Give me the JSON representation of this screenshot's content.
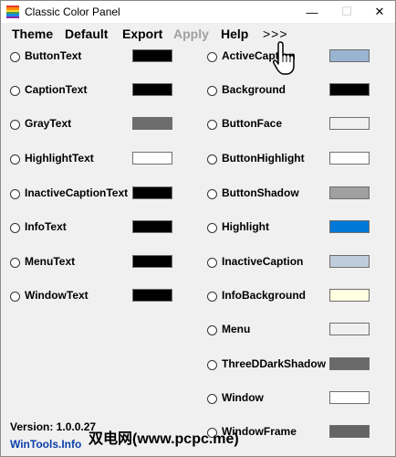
{
  "window": {
    "title": "Classic Color Panel",
    "caption_buttons": {
      "minimize": "—",
      "maximize": "☐",
      "close": "✕"
    }
  },
  "menu": {
    "theme": "Theme",
    "default": "Default",
    "export": "Export",
    "apply": "Apply",
    "help": "Help",
    "more": ">>>"
  },
  "left_column": [
    {
      "label": "ButtonText",
      "color": "#000000"
    },
    {
      "label": "CaptionText",
      "color": "#000000"
    },
    {
      "label": "GrayText",
      "color": "#6d6d6d"
    },
    {
      "label": "HighlightText",
      "color": "#ffffff"
    },
    {
      "label": "InactiveCaptionText",
      "color": "#000000"
    },
    {
      "label": "InfoText",
      "color": "#000000"
    },
    {
      "label": "MenuText",
      "color": "#000000"
    },
    {
      "label": "WindowText",
      "color": "#000000"
    }
  ],
  "right_column": [
    {
      "label": "ActiveCaption",
      "color": "#99b4d1"
    },
    {
      "label": "Background",
      "color": "#000000"
    },
    {
      "label": "ButtonFace",
      "color": "#f0f0f0"
    },
    {
      "label": "ButtonHighlight",
      "color": "#ffffff"
    },
    {
      "label": "ButtonShadow",
      "color": "#a0a0a0"
    },
    {
      "label": "Highlight",
      "color": "#0078d7"
    },
    {
      "label": "InactiveCaption",
      "color": "#bfcddb"
    },
    {
      "label": "InfoBackground",
      "color": "#ffffe1"
    },
    {
      "label": "Menu",
      "color": "#f0f0f0"
    },
    {
      "label": "ThreeDDarkShadow",
      "color": "#696969"
    },
    {
      "label": "Window",
      "color": "#ffffff"
    },
    {
      "label": "WindowFrame",
      "color": "#646464"
    }
  ],
  "footer": {
    "version": "Version: 1.0.0.27",
    "site": "WinTools.Info"
  },
  "watermark": "双电网(www.pcpc.me)",
  "icons": {
    "app": "rainbow-palette-icon",
    "cursor": "hand-pointer-icon"
  }
}
